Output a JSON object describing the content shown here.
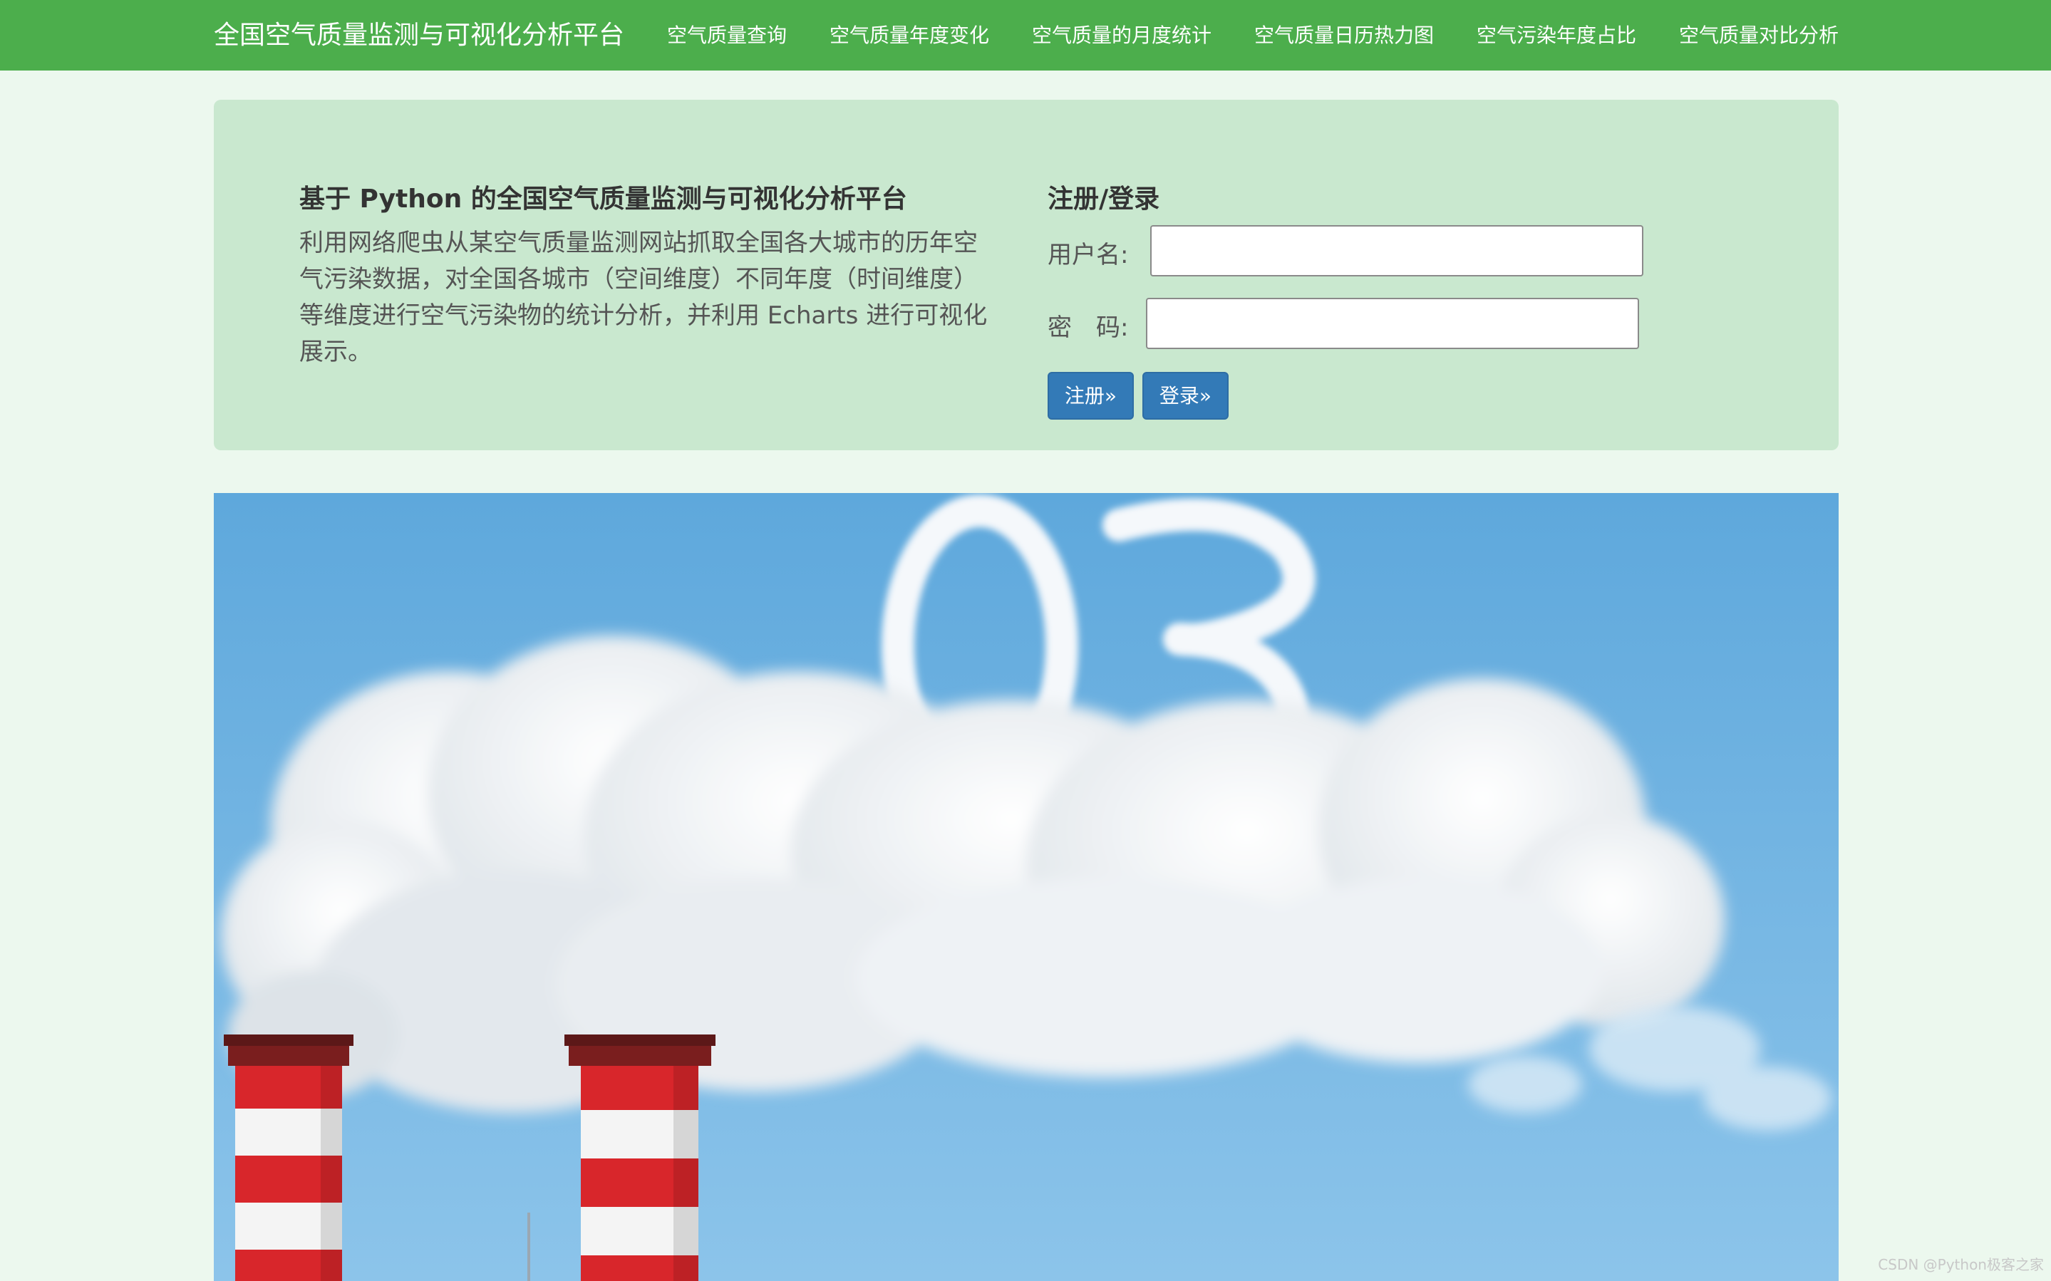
{
  "nav": {
    "brand": "全国空气质量监测与可视化分析平台",
    "links": [
      "空气质量查询",
      "空气质量年度变化",
      "空气质量的月度统计",
      "空气质量日历热力图",
      "空气污染年度占比",
      "空气质量对比分析"
    ]
  },
  "intro": {
    "title": "基于 Python 的全国空气质量监测与可视化分析平台",
    "text": "利用网络爬虫从某空气质量监测网站抓取全国各大城市的历年空气污染数据，对全国各城市（空间维度）不同年度（时间维度）等维度进行空气污染物的统计分析，并利用 Echarts 进行可视化展示。"
  },
  "login": {
    "title": "注册/登录",
    "username_label": "用户名:",
    "password_label": "密　码:",
    "username_value": "",
    "password_value": "",
    "register_button": "注册»",
    "login_button": "登录»"
  },
  "banner": {
    "cloud_text": "O3"
  },
  "watermark": "CSDN @Python极客之家",
  "colors": {
    "navbar": "#4cae4c",
    "page_background": "#ecf8ee",
    "hero_background": "#c9e8cf",
    "button": "#337ab7",
    "sky": "#5ea8dc",
    "chimney_red": "#d8262b"
  }
}
